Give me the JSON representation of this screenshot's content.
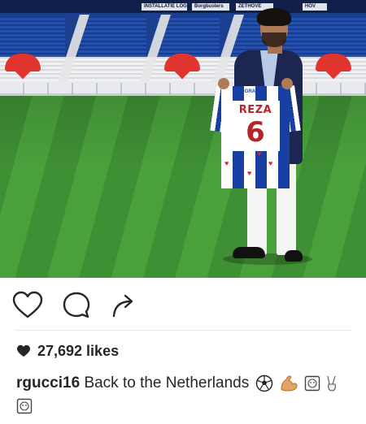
{
  "photo": {
    "stadium_ads": [
      "INSTALLATIE LOGE",
      "Borgbusters",
      "ZETHOVE",
      "HOV"
    ],
    "jersey": {
      "sponsor": "GRANDO",
      "name": "REZA",
      "number": "6"
    }
  },
  "actions": {
    "like_icon": "heart-outline-icon",
    "comment_icon": "comment-bubble-icon",
    "share_icon": "share-arrow-icon"
  },
  "likes": {
    "icon": "heart-filled-icon",
    "text": "27,692 likes"
  },
  "caption": {
    "username": "rgucci16",
    "text": "Back to the Netherlands",
    "emojis": [
      "soccer-ball",
      "flexed-biceps",
      "framed-face",
      "victory-hand",
      "framed-face"
    ]
  },
  "colors": {
    "text": "#262626",
    "divider": "#e6e6e6",
    "jersey_blue": "#1a3fa2",
    "jersey_red": "#b8232a"
  }
}
